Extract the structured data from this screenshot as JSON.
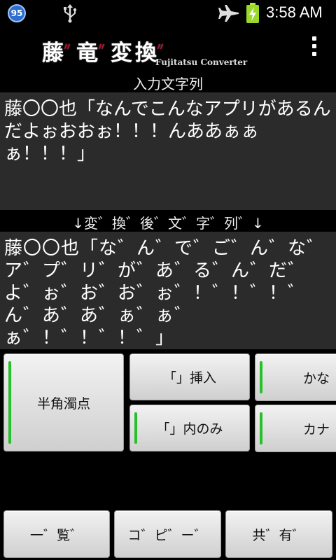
{
  "status_bar": {
    "notification_count": "95",
    "time": "3:58 AM"
  },
  "app_bar": {
    "logo_jp": [
      "藤",
      "竜",
      "変",
      "換"
    ],
    "logo_en": "Fujitatsu Converter"
  },
  "input": {
    "label": "入力文字列",
    "text": "藤〇〇也「なんでこんなアプリがあるんだよぉおおぉ！！！んああぁぁぁ！！！」"
  },
  "output": {
    "label": "↓変゛換゛後゛文゛字゛列゛↓",
    "text": "藤〇〇也「な゛ん゛で゛ご゛ん゛な゛ア゛プ゛リ゛が゛あ゛る゛ん゛だ゛よ゛ぉ゛お゛お゛ぉ゛！゛！゛！゛ん゛あ゛あ゛ぁ゛ぁ゛ぁ゛！゛！゛！゛」"
  },
  "buttons": {
    "hankaku_dakuten": "半角濁点",
    "bracket_insert": "「」挿入",
    "bracket_only": "「」内のみ",
    "hiragana": "かな",
    "katakana": "カナ",
    "list": "一゛覧゛",
    "copy": "コ゛ピ゛ー゛",
    "share": "共゛有゛"
  },
  "colors": {
    "toggle_on": "#27c02a",
    "text_area_bg": "#2b2b2b",
    "logo_accent": "#c0102a"
  }
}
